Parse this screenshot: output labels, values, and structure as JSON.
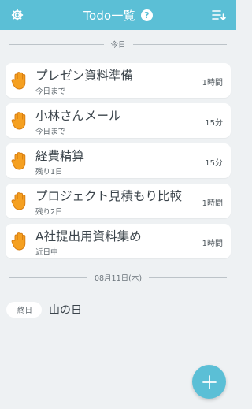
{
  "header": {
    "title": "Todo一覧",
    "help_label": "?",
    "left_icon": "gear-icon",
    "right_icon": "sort-list-icon",
    "accent_color": "#5bbfd6"
  },
  "sections": [
    {
      "date_label": "今日",
      "tasks": [
        {
          "title": "プレゼン資料準備",
          "due": "今日まで",
          "duration": "1時間",
          "icon": "raised-hand-icon"
        },
        {
          "title": "小林さんメール",
          "due": "今日まで",
          "duration": "15分",
          "icon": "raised-hand-icon"
        },
        {
          "title": "経費精算",
          "due": "残り1日",
          "duration": "15分",
          "icon": "raised-hand-icon"
        },
        {
          "title": "プロジェクト見積もり比較",
          "due": "残り2日",
          "duration": "1時間",
          "icon": "raised-hand-icon"
        },
        {
          "title": "A社提出用資料集め",
          "due": "近日中",
          "duration": "1時間",
          "icon": "raised-hand-icon"
        }
      ]
    },
    {
      "date_label": "08月11日(木)",
      "events": [
        {
          "badge": "終日",
          "title": "山の日"
        }
      ]
    }
  ],
  "fab": {
    "icon": "plus-icon"
  }
}
